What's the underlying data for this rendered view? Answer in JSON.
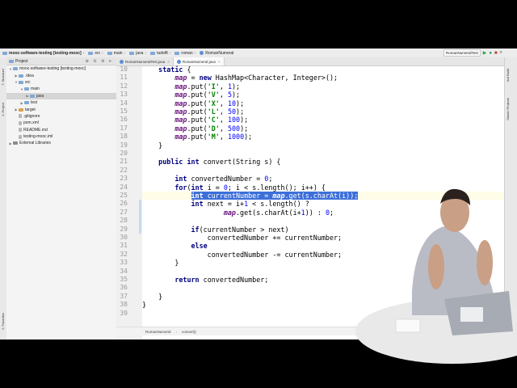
{
  "navbar": {
    "crumbs": [
      "mooc-software-testing [testing-mooc]",
      "src",
      "main",
      "java",
      "tudelft",
      "roman",
      "RomanNumeral"
    ],
    "run_config": "RomanNumeralTest"
  },
  "side_tabs": {
    "project": "1: Project",
    "structure": "7: Structure",
    "favorites": "2: Favorites",
    "ant": "Ant Build",
    "maven": "Maven Projects"
  },
  "project": {
    "header": "Project",
    "tree": [
      {
        "label": "mooc-software-testing [testing-mooc]",
        "depth": 0,
        "arrow": "▼",
        "icon": "folder"
      },
      {
        "label": ".idea",
        "depth": 1,
        "arrow": "▶",
        "icon": "folder"
      },
      {
        "label": "src",
        "depth": 1,
        "arrow": "▼",
        "icon": "folder"
      },
      {
        "label": "main",
        "depth": 2,
        "arrow": "▼",
        "icon": "folder"
      },
      {
        "label": "java",
        "depth": 3,
        "arrow": "▶",
        "icon": "folder",
        "selected": true
      },
      {
        "label": "test",
        "depth": 2,
        "arrow": "▶",
        "icon": "folder"
      },
      {
        "label": "target",
        "depth": 1,
        "arrow": "▶",
        "icon": "folder-orange"
      },
      {
        "label": ".gitignore",
        "depth": 1,
        "arrow": "",
        "icon": "file"
      },
      {
        "label": "pom.xml",
        "depth": 1,
        "arrow": "",
        "icon": "file"
      },
      {
        "label": "README.md",
        "depth": 1,
        "arrow": "",
        "icon": "file"
      },
      {
        "label": "testing-mooc.iml",
        "depth": 1,
        "arrow": "",
        "icon": "file"
      },
      {
        "label": "External Libraries",
        "depth": 0,
        "arrow": "▶",
        "icon": "lib"
      }
    ]
  },
  "tabs": [
    {
      "label": "RomanNumeralTest.java",
      "active": false
    },
    {
      "label": "RomanNumeral.java",
      "active": true
    }
  ],
  "editor": {
    "lines": [
      {
        "n": "10",
        "code": "    static {"
      },
      {
        "n": "11",
        "code": "        map = new HashMap<Character, Integer>();"
      },
      {
        "n": "12",
        "code": "        map.put('I', 1);"
      },
      {
        "n": "13",
        "code": "        map.put('V', 5);"
      },
      {
        "n": "14",
        "code": "        map.put('X', 10);"
      },
      {
        "n": "15",
        "code": "        map.put('L', 50);"
      },
      {
        "n": "16",
        "code": "        map.put('C', 100);"
      },
      {
        "n": "17",
        "code": "        map.put('D', 500);"
      },
      {
        "n": "18",
        "code": "        map.put('M', 1000);"
      },
      {
        "n": "19",
        "code": "    }"
      },
      {
        "n": "20",
        "code": ""
      },
      {
        "n": "21",
        "code": "    public int convert(String s) {"
      },
      {
        "n": "22",
        "code": ""
      },
      {
        "n": "23",
        "code": "        int convertedNumber = 0;"
      },
      {
        "n": "24",
        "code": "        for(int i = 0; i < s.length(); i++) {"
      },
      {
        "n": "25",
        "code": "            int currentNumber = map.get(s.charAt(i));"
      },
      {
        "n": "26",
        "code": "            int next = i+1 < s.length() ?"
      },
      {
        "n": "27",
        "code": "                    map.get(s.charAt(i+1)) : 0;"
      },
      {
        "n": "28",
        "code": ""
      },
      {
        "n": "29",
        "code": "            if(currentNumber > next)"
      },
      {
        "n": "30",
        "code": "                convertedNumber += currentNumber;"
      },
      {
        "n": "31",
        "code": "            else"
      },
      {
        "n": "32",
        "code": "                convertedNumber -= currentNumber;"
      },
      {
        "n": "33",
        "code": "        }"
      },
      {
        "n": "34",
        "code": ""
      },
      {
        "n": "35",
        "code": "        return convertedNumber;"
      },
      {
        "n": "36",
        "code": ""
      },
      {
        "n": "37",
        "code": "    }"
      },
      {
        "n": "38",
        "code": "}"
      },
      {
        "n": "39",
        "code": ""
      }
    ],
    "selected_line": "25"
  },
  "status_crumbs": [
    "RomanNumeral",
    "convert()"
  ],
  "colors": {
    "selection": "#3d6fd9",
    "keyword": "#000080",
    "field": "#660e7a",
    "number": "#0000ff",
    "string": "#008000"
  }
}
